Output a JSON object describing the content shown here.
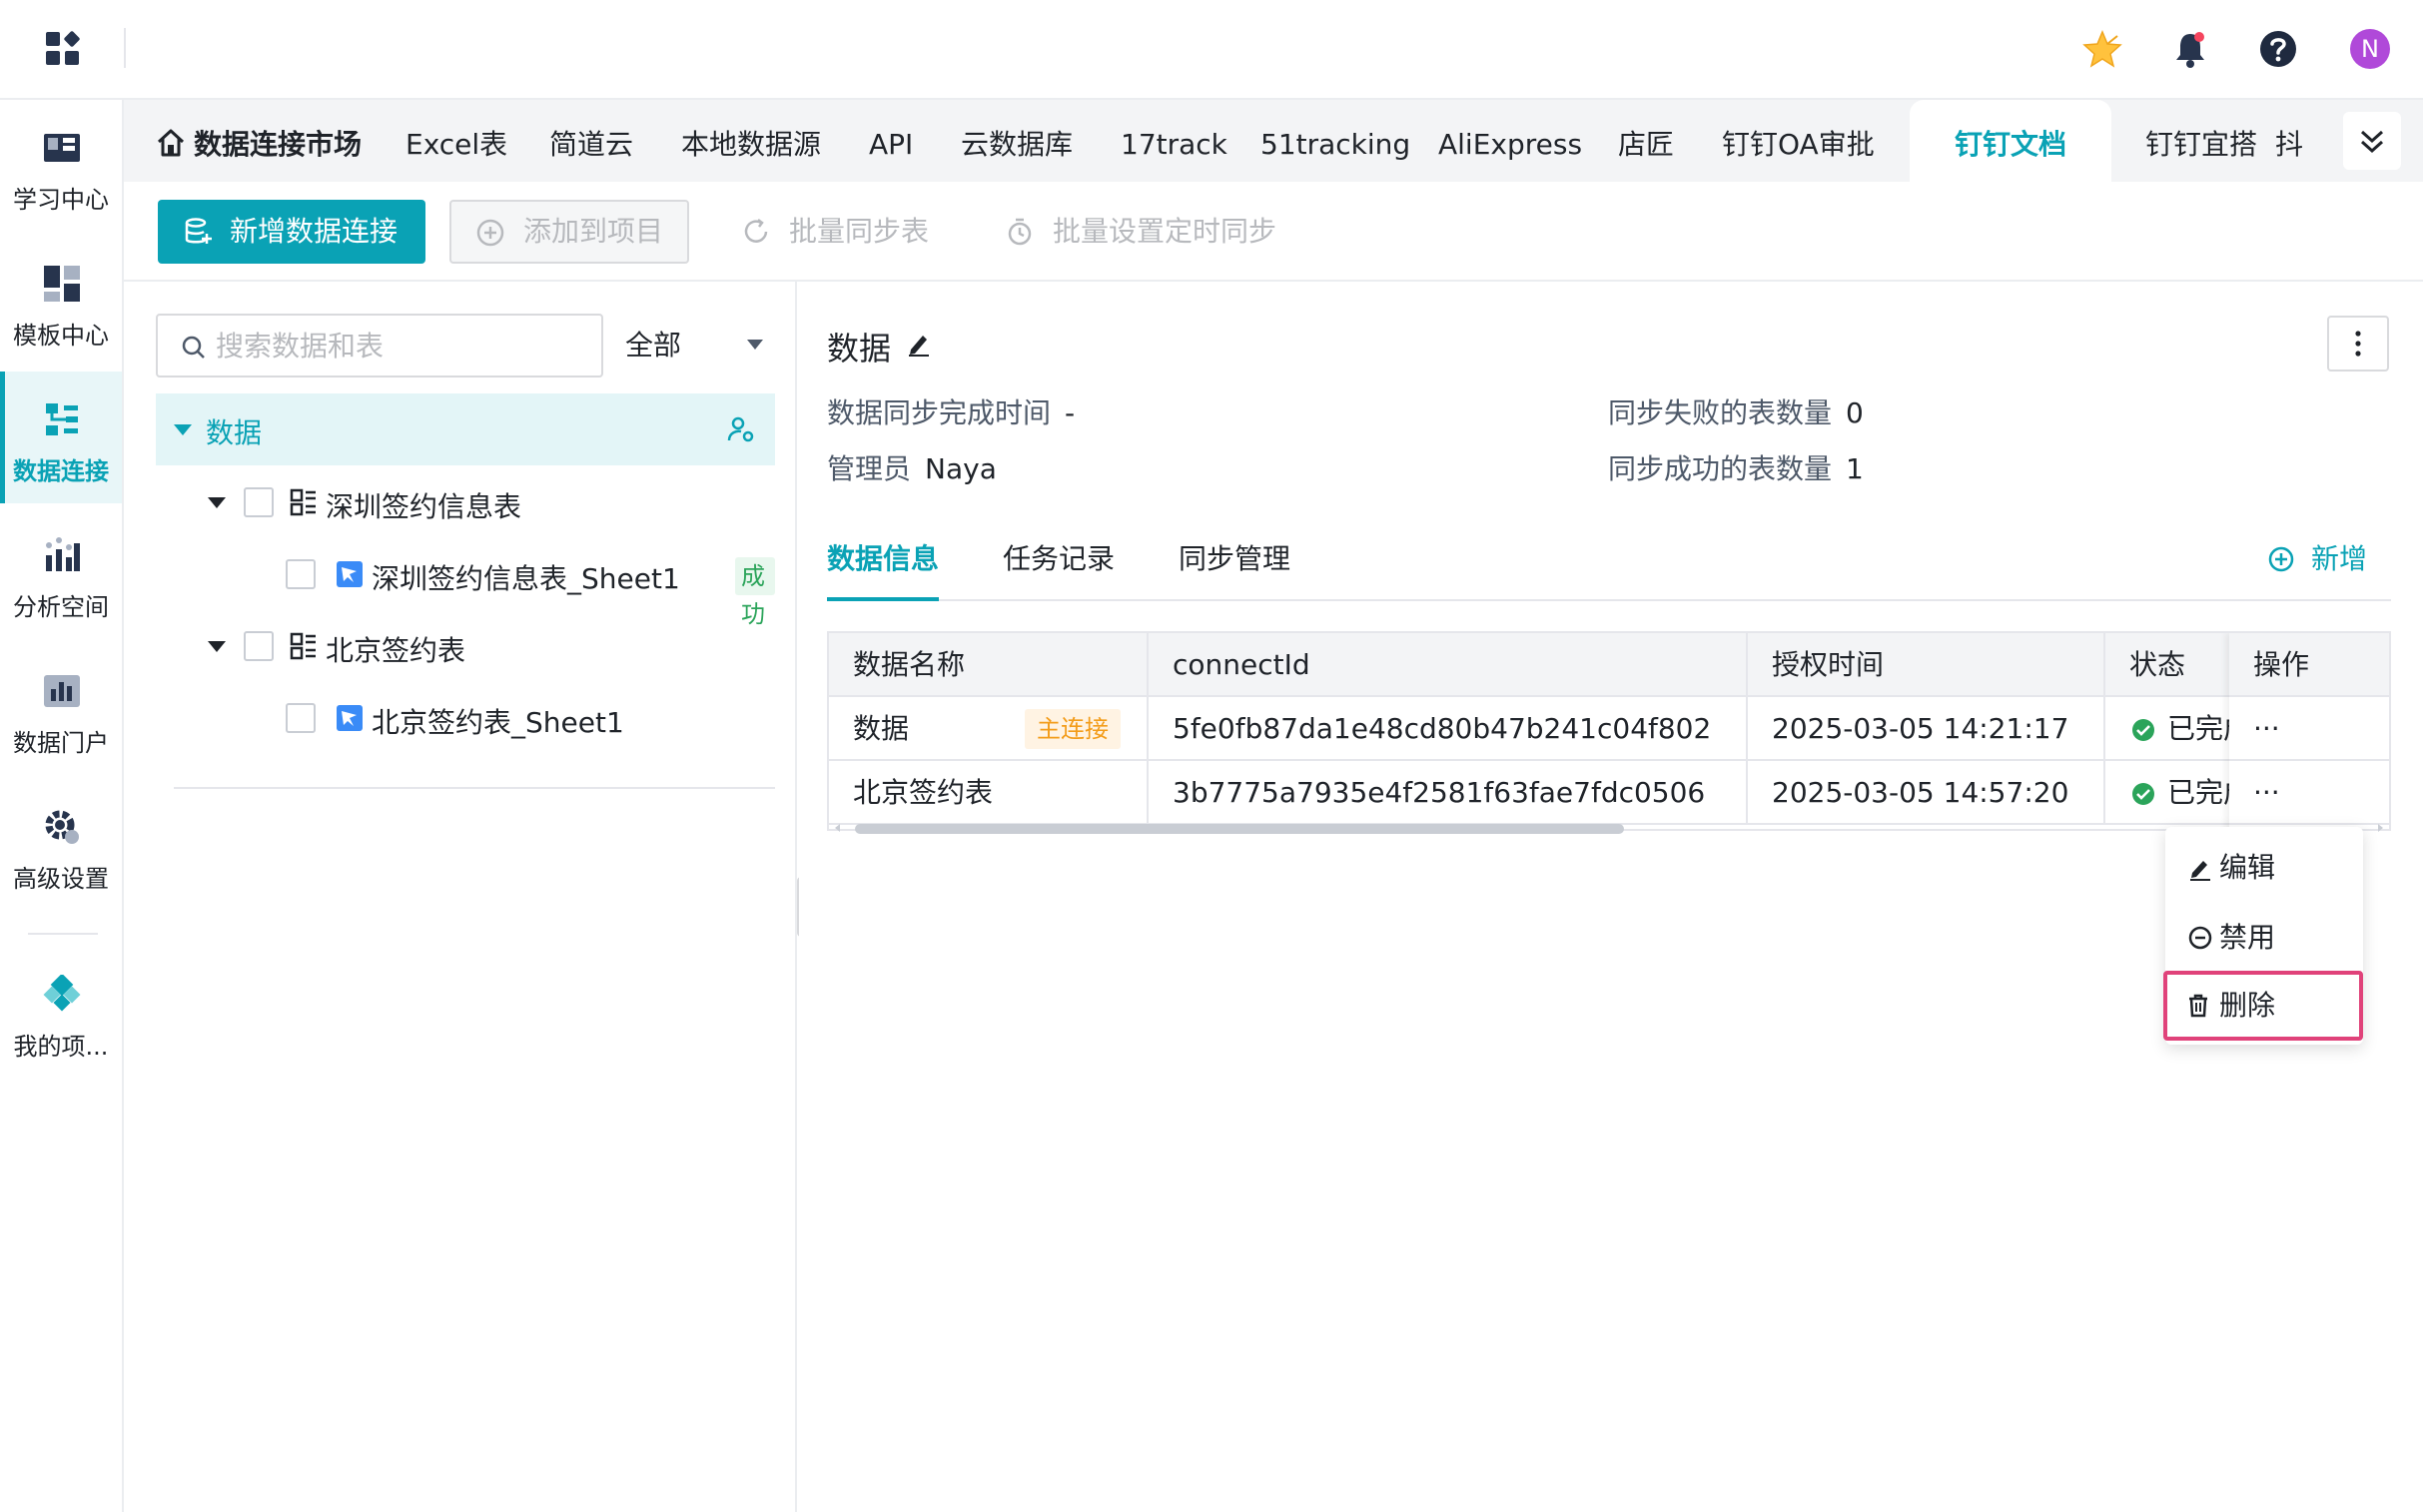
{
  "app": {
    "brand_color": "#0aa2b5",
    "avatar_letter": "N",
    "top_icons": [
      "star-icon",
      "bell-icon",
      "help-icon",
      "avatar"
    ]
  },
  "sidebar": {
    "items": [
      {
        "label": "学习中心",
        "icon": "book-icon"
      },
      {
        "label": "模板中心",
        "icon": "template-icon"
      },
      {
        "label": "数据连接",
        "icon": "data-connect-icon",
        "active": true
      },
      {
        "label": "分析空间",
        "icon": "analysis-icon"
      },
      {
        "label": "数据门户",
        "icon": "portal-icon"
      },
      {
        "label": "高级设置",
        "icon": "gear-icon"
      },
      {
        "label": "我的项...",
        "icon": "project-icon"
      }
    ]
  },
  "tabs": {
    "home": "数据连接市场",
    "items": [
      "Excel表",
      "简道云",
      "本地数据源",
      "API",
      "云数据库",
      "17track",
      "51tracking",
      "AliExpress",
      "店匠",
      "钉钉OA审批",
      "钉钉文档",
      "钉钉宜搭",
      "抖"
    ],
    "active": "钉钉文档"
  },
  "toolbar": {
    "new_connection": "新增数据连接",
    "add_to_project": "添加到项目",
    "batch_sync": "批量同步表",
    "batch_schedule": "批量设置定时同步"
  },
  "tree": {
    "search_placeholder": "搜索数据和表",
    "filter_value": "全部",
    "root_label": "数据",
    "nodes": [
      {
        "label": "深圳签约信息表",
        "children": [
          {
            "label": "深圳签约信息表_Sheet1",
            "status": "成功"
          }
        ]
      },
      {
        "label": "北京签约表",
        "children": [
          {
            "label": "北京签约表_Sheet1"
          }
        ]
      }
    ]
  },
  "detail": {
    "title": "数据",
    "sync_time_label": "数据同步完成时间",
    "sync_time_value": "-",
    "admin_label": "管理员",
    "admin_value": "Naya",
    "fail_count_label": "同步失败的表数量",
    "fail_count_value": "0",
    "success_count_label": "同步成功的表数量",
    "success_count_value": "1",
    "subtabs": [
      "数据信息",
      "任务记录",
      "同步管理"
    ],
    "add_label": "新增"
  },
  "table": {
    "headers": [
      "数据名称",
      "connectId",
      "授权时间",
      "状态",
      "操作"
    ],
    "rows": [
      {
        "name": "数据",
        "tag": "主连接",
        "connectId": "5fe0fb87da1e48cd80b47b241c04f802",
        "time": "2025-03-05 14:21:17",
        "status": "已完成",
        "op": "···"
      },
      {
        "name": "北京签约表",
        "tag": "",
        "connectId": "3b7775a7935e4f2581f63fae7fdc0506",
        "time": "2025-03-05 14:57:20",
        "status": "已完成",
        "op": "···"
      }
    ]
  },
  "menu": {
    "items": [
      {
        "label": "编辑",
        "icon": "edit-icon"
      },
      {
        "label": "禁用",
        "icon": "disable-icon"
      },
      {
        "label": "删除",
        "icon": "trash-icon",
        "highlighted": true
      }
    ]
  }
}
